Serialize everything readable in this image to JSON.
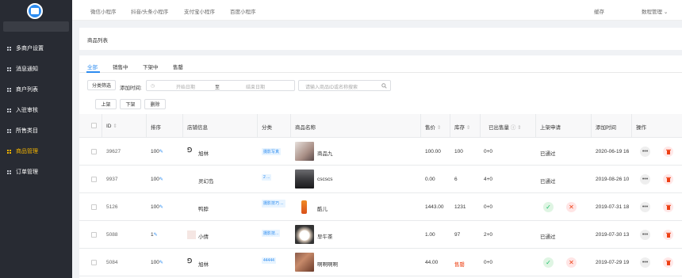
{
  "top_tabs": [
    "微信小程序",
    "抖音/头条小程序",
    "支付宝小程序",
    "百度小程序"
  ],
  "top_right": {
    "cache": "缓存",
    "user": "数程管理"
  },
  "sidebar": {
    "items": [
      {
        "label": "多商户设置"
      },
      {
        "label": "消息通知"
      },
      {
        "label": "商户列表"
      },
      {
        "label": "入驻审核"
      },
      {
        "label": "所售类目"
      },
      {
        "label": "商品管理",
        "active": true
      },
      {
        "label": "订单管理"
      }
    ]
  },
  "breadcrumb": "商品列表",
  "tabs": [
    "全部",
    "销售中",
    "下架中",
    "售罄"
  ],
  "filters": {
    "category_btn": "分类筛选",
    "add_time_label": "添加时间:",
    "start_placeholder": "开始日期",
    "to": "至",
    "end_placeholder": "结束日期",
    "search_placeholder": "请输入商品ID或名称搜索"
  },
  "actions": {
    "up": "上架",
    "down": "下架",
    "delete": "删除"
  },
  "columns": [
    "ID",
    "排序",
    "店铺信息",
    "分类",
    "商品名称",
    "售价",
    "库存",
    "已出售量",
    "上架申请",
    "添加时间",
    "操作"
  ],
  "rows": [
    {
      "id": "39627",
      "sort": "100",
      "shop": "旭林",
      "cat": "摄影写真",
      "name": "商品九",
      "price": "100.00",
      "stock": "100",
      "sold": "0+0",
      "apply": "已通过",
      "time": "2020-06-19 16"
    },
    {
      "id": "9937",
      "sort": "100",
      "shop": "灵幻岛",
      "cat": "2 ...",
      "name": "cscscs",
      "price": "0.00",
      "stock": "6",
      "sold": "4+0",
      "apply": "已通过",
      "time": "2019-08-26 10"
    },
    {
      "id": "5126",
      "sort": "100",
      "shop": "鸭脖",
      "cat": "摄影技巧 ...",
      "name": "酷儿",
      "price": "1443.00",
      "stock": "1231",
      "sold": "0+0",
      "apply": "",
      "time": "2019-07-31 18"
    },
    {
      "id": "5088",
      "sort": "1",
      "shop": "小倩",
      "cat": "摄影技...",
      "name": "早午茶",
      "price": "1.00",
      "stock": "97",
      "sold": "2+0",
      "apply": "已通过",
      "time": "2019-07-30 13"
    },
    {
      "id": "5084",
      "sort": "100",
      "shop": "旭林",
      "cat": "44444",
      "name": "啊啊啊啊",
      "price": "44.00",
      "stock": "售罄",
      "sold": "0+0",
      "apply": "",
      "time": "2019-07-29 19"
    }
  ],
  "colors": {
    "accent": "#2d8cf0",
    "sidebar_bg": "#282b33",
    "active_menu": "#f4b400",
    "soldout": "#ed4014"
  }
}
